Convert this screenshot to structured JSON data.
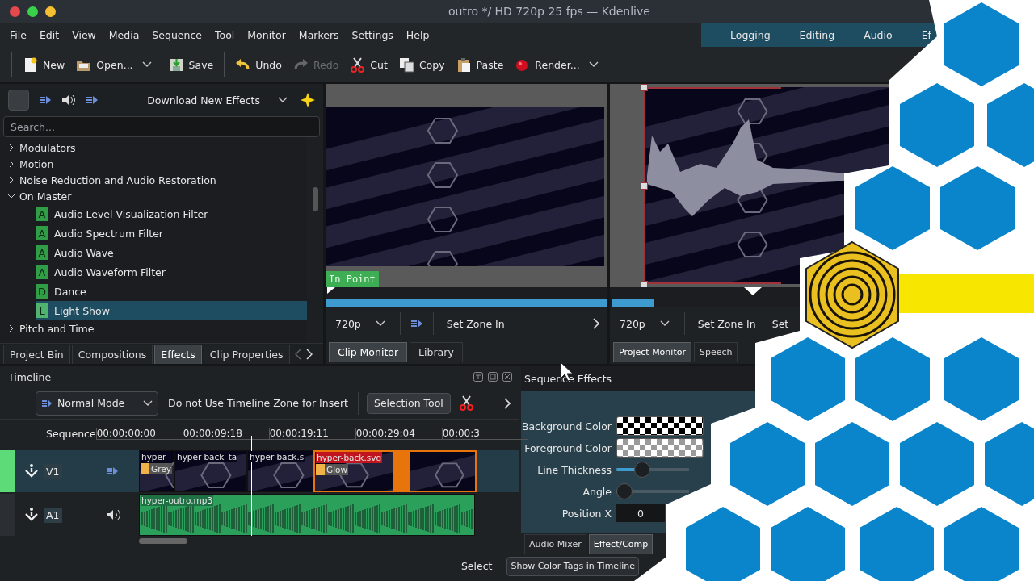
{
  "window": {
    "title": "outro */ HD 720p 25 fps — Kdenlive",
    "controls": [
      {
        "kind": "close"
      },
      {
        "kind": "maximize"
      },
      {
        "kind": "minimize"
      }
    ]
  },
  "menu": [
    "File",
    "Edit",
    "View",
    "Media",
    "Sequence",
    "Tool",
    "Monitor",
    "Markers",
    "Settings",
    "Help"
  ],
  "workspaces": [
    {
      "label": "Logging",
      "selected": false
    },
    {
      "label": "Editing",
      "selected": false
    },
    {
      "label": "Audio",
      "selected": false
    },
    {
      "label": "Ef",
      "selected": false
    }
  ],
  "toolbar": {
    "groups": [
      [
        {
          "kind": "new",
          "label": "New",
          "disabled": false,
          "dropdown": false
        },
        {
          "kind": "open",
          "label": "Open...",
          "disabled": false,
          "dropdown": true
        },
        {
          "kind": "save",
          "label": "Save",
          "disabled": false,
          "dropdown": false
        }
      ],
      [
        {
          "kind": "undo",
          "label": "Undo",
          "disabled": false,
          "dropdown": false
        },
        {
          "kind": "redo",
          "label": "Redo",
          "disabled": true,
          "dropdown": false
        },
        {
          "kind": "cut",
          "label": "Cut",
          "disabled": false,
          "dropdown": false
        },
        {
          "kind": "copy",
          "label": "Copy",
          "disabled": false,
          "dropdown": false
        },
        {
          "kind": "paste",
          "label": "Paste",
          "disabled": false,
          "dropdown": false
        },
        {
          "kind": "render",
          "label": "Render...",
          "disabled": false,
          "dropdown": true
        }
      ]
    ]
  },
  "effects_panel": {
    "download": "Download New Effects",
    "search": {
      "placeholder": "Search..."
    },
    "tree": [
      {
        "label": "Modulators",
        "expanded": false,
        "selected": false
      },
      {
        "label": "Motion",
        "expanded": false,
        "selected": false
      },
      {
        "label": "Noise Reduction and Audio Restoration",
        "expanded": false,
        "selected": false
      },
      {
        "label": "On Master",
        "expanded": true,
        "selected": false,
        "children": [
          {
            "badge": "A",
            "label": "Audio Level Visualization Filter",
            "selected": false
          },
          {
            "badge": "A",
            "label": "Audio Spectrum Filter",
            "selected": false
          },
          {
            "badge": "A",
            "label": "Audio Wave",
            "selected": false
          },
          {
            "badge": "A",
            "label": "Audio Waveform Filter",
            "selected": false
          },
          {
            "badge": "D",
            "label": "Dance",
            "selected": false
          },
          {
            "badge": "L",
            "label": "Light Show",
            "selected": true
          }
        ]
      },
      {
        "label": "Pitch and Time",
        "expanded": false,
        "selected": false
      }
    ],
    "tabs": [
      {
        "label": "Project Bin",
        "selected": false
      },
      {
        "label": "Compositions",
        "selected": false
      },
      {
        "label": "Effects",
        "selected": true
      },
      {
        "label": "Clip Properties",
        "selected": false
      }
    ]
  },
  "clip_monitor": {
    "marker": "In Point",
    "resolution": "720p",
    "buttons": [
      "Set Zone In"
    ],
    "tabs": [
      {
        "label": "Clip Monitor",
        "selected": true
      },
      {
        "label": "Library",
        "selected": false
      }
    ]
  },
  "project_monitor": {
    "resolution": "720p",
    "buttons": [
      "Set Zone In",
      "Set"
    ],
    "tabs": [
      {
        "label": "Project Monitor",
        "selected": true
      },
      {
        "label": "Speech",
        "selected": false
      }
    ]
  },
  "timeline": {
    "title": "Timeline",
    "mode": "Normal Mode",
    "zone_option": "Do not Use Timeline Zone for Insert",
    "tool": "Selection Tool",
    "header": "Sequence",
    "ticks": [
      "00:00:00:00",
      "00:00:09:18",
      "00:00:19:11",
      "00:00:29:04",
      "00:00:3"
    ],
    "tracks": [
      {
        "name": "V1",
        "kind": "video",
        "active": true,
        "clips": [
          {
            "kind": "clip",
            "name": "hyper-",
            "effect": "Grey",
            "selected": false
          },
          {
            "kind": "clip",
            "name": "hyper-back_ta",
            "selected": false
          },
          {
            "kind": "clip",
            "name": "hyper-back.s",
            "selected": false
          },
          {
            "kind": "clip",
            "name": "hyper-back.svg",
            "effect": "Glow",
            "selected": true
          },
          {
            "kind": "transition",
            "selected": true
          },
          {
            "kind": "clip",
            "selected": true
          }
        ]
      },
      {
        "name": "A1",
        "kind": "audio",
        "active": false,
        "clips": [
          {
            "kind": "clip",
            "name": "hyper-outro.mp3",
            "selected": false
          }
        ]
      }
    ]
  },
  "effect_stack": {
    "title": "Sequence Effects",
    "params": [
      {
        "kind": "color",
        "label": "Background Color",
        "color": "#000000"
      },
      {
        "kind": "color",
        "label": "Foreground Color",
        "color": "#9a9a9a"
      },
      {
        "kind": "slider",
        "label": "Line Thickness",
        "level": 0.31
      },
      {
        "kind": "slider",
        "label": "Angle",
        "level": 0
      },
      {
        "kind": "number",
        "label": "Position X",
        "value": "0"
      }
    ],
    "tabs": [
      {
        "label": "Audio Mixer",
        "selected": false
      },
      {
        "label": "Effect/Comp",
        "selected": true
      }
    ]
  },
  "status_bar": {
    "tool": "Select",
    "button": "Show Color Tags in Timeline"
  }
}
